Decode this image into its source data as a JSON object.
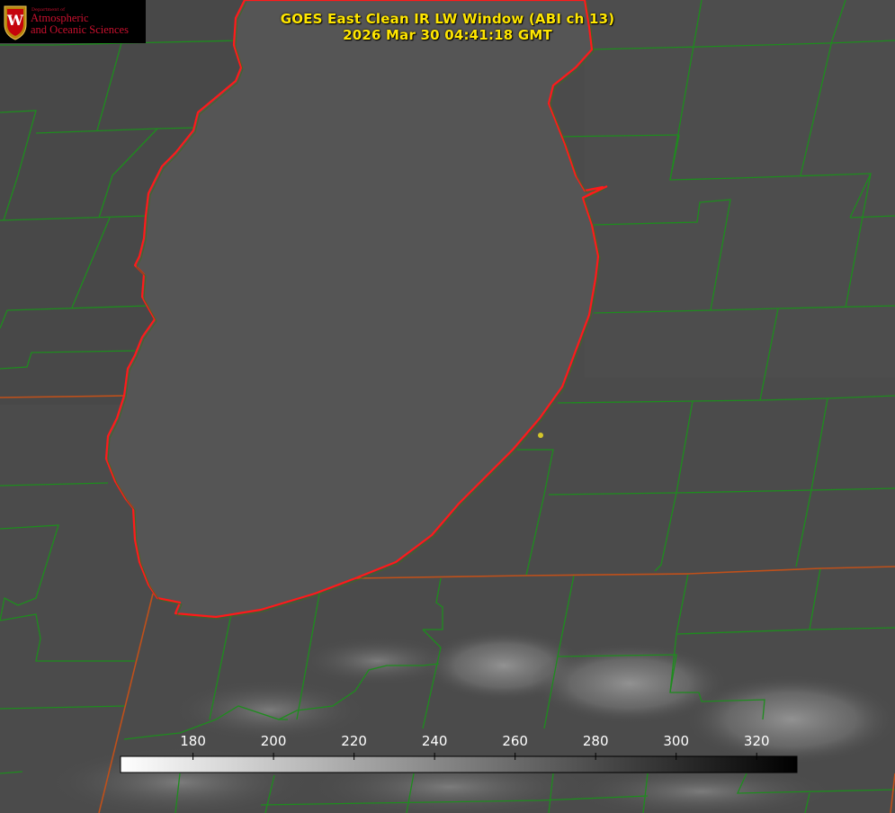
{
  "title": {
    "line1": "GOES East Clean IR LW Window (ABI ch 13)",
    "line2": "2026 Mar 30 04:41:18 GMT"
  },
  "logo": {
    "dept_text": "Department of",
    "line1": "Atmospheric",
    "line2": "and Oceanic Sciences",
    "crest_letter": "W",
    "icon": "uw-crest-icon"
  },
  "colorbar": {
    "ticks": [
      "180",
      "200",
      "220",
      "240",
      "260",
      "280",
      "300",
      "320"
    ],
    "tick_values": [
      180,
      200,
      220,
      240,
      260,
      280,
      300,
      320
    ],
    "vmin": 162,
    "vmax": 330,
    "cmap": "white-to-black"
  },
  "colors": {
    "title": "#ffe600",
    "lake_outline": "#ff1a1a",
    "county_lines": "#1e8c1e",
    "state_lines": "#c0501a",
    "marker": "#d4c62a"
  }
}
